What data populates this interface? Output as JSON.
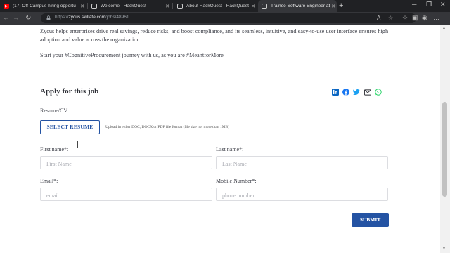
{
  "browser": {
    "tabs": [
      {
        "title": "(17) Off-Campus hiring opportu",
        "icon": "youtube-icon"
      },
      {
        "title": "Welcome - HackQuest",
        "icon": "page-icon"
      },
      {
        "title": "About HackQuest - HackQuest",
        "icon": "page-icon"
      },
      {
        "title": "Trainee Software Engineer at Zyc",
        "icon": "page-icon"
      }
    ],
    "url_prefix": "https://",
    "url_host": "zycus.skillate.com",
    "url_path": "/jobs/48961",
    "new_tab": "+"
  },
  "page": {
    "intro_text": "Zycus helps enterprises drive real savings, reduce risks, and boost compliance, and its seamless, intuitive, and easy-to-use user interface ensures high adoption and value across the organization.",
    "journey_text": "Start your #CognitiveProcurement journey with us, as you are #MeantforMore",
    "apply_title": "Apply for this job",
    "resume_label": "Resume/CV",
    "select_resume_label": "SELECT RESUME",
    "upload_hint": "Upload in either DOC, DOCX or PDF file format (file size not more than 1MB)",
    "first_name_label": "First name*:",
    "first_name_placeholder": "First Name",
    "last_name_label": "Last name*:",
    "last_name_placeholder": "Last Name",
    "email_label": "Email*:",
    "email_placeholder": "email",
    "mobile_label": "Mobile Number*:",
    "mobile_placeholder": "phone number",
    "submit_label": "SUBMIT"
  },
  "share_icons": [
    "linkedin-icon",
    "facebook-icon",
    "twitter-icon",
    "email-icon",
    "whatsapp-icon"
  ],
  "colors": {
    "accent": "#2453a3",
    "linkedin": "#0a66c2",
    "facebook": "#1877f2",
    "twitter": "#1da1f2",
    "whatsapp": "#25d366"
  }
}
